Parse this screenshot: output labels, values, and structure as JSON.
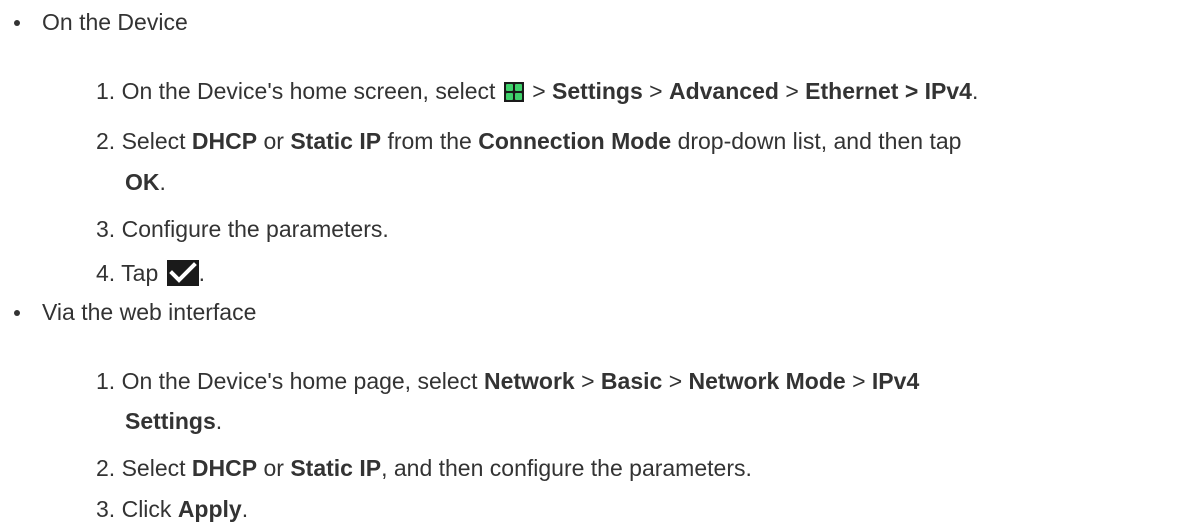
{
  "sections": [
    {
      "title": "On the Device",
      "steps": [
        {
          "num": "1.",
          "parts": {
            "a": "On the Device's home screen, select",
            "b": ">",
            "c": "Settings",
            "d": ">",
            "e": "Advanced",
            "f": ">",
            "g": "Ethernet > IPv4",
            "h": "."
          }
        },
        {
          "num": "2.",
          "parts": {
            "a": "Select",
            "b": "DHCP",
            "c": "or",
            "d": "Static IP",
            "e": "from the",
            "f": "Connection Mode",
            "g": "drop-down list, and then tap",
            "h": "OK",
            "i": "."
          }
        },
        {
          "num": "3.",
          "text": "Configure the parameters."
        },
        {
          "num": "4.",
          "parts": {
            "a": "Tap",
            "b": "."
          }
        }
      ]
    },
    {
      "title": "Via the web interface",
      "steps": [
        {
          "num": "1.",
          "parts": {
            "a": "On the Device's home page, select",
            "b": "Network",
            "c": ">",
            "d": "Basic",
            "e": ">",
            "f": "Network Mode",
            "g": ">",
            "h": "IPv4",
            "i": "Settings",
            "j": "."
          }
        },
        {
          "num": "2.",
          "parts": {
            "a": "Select",
            "b": "DHCP",
            "c": "or",
            "d": "Static IP",
            "e": ", and then configure the parameters."
          }
        },
        {
          "num": "3.",
          "parts": {
            "a": "Click",
            "b": "Apply",
            "c": "."
          }
        }
      ]
    }
  ],
  "icons": {
    "apps": "apps-grid-icon",
    "confirm": "checkmark-icon",
    "apps_color": "#3fd16b",
    "icon_bg": "#1a1a1a"
  },
  "colors": {
    "text": "#333333",
    "background": "#ffffff"
  }
}
